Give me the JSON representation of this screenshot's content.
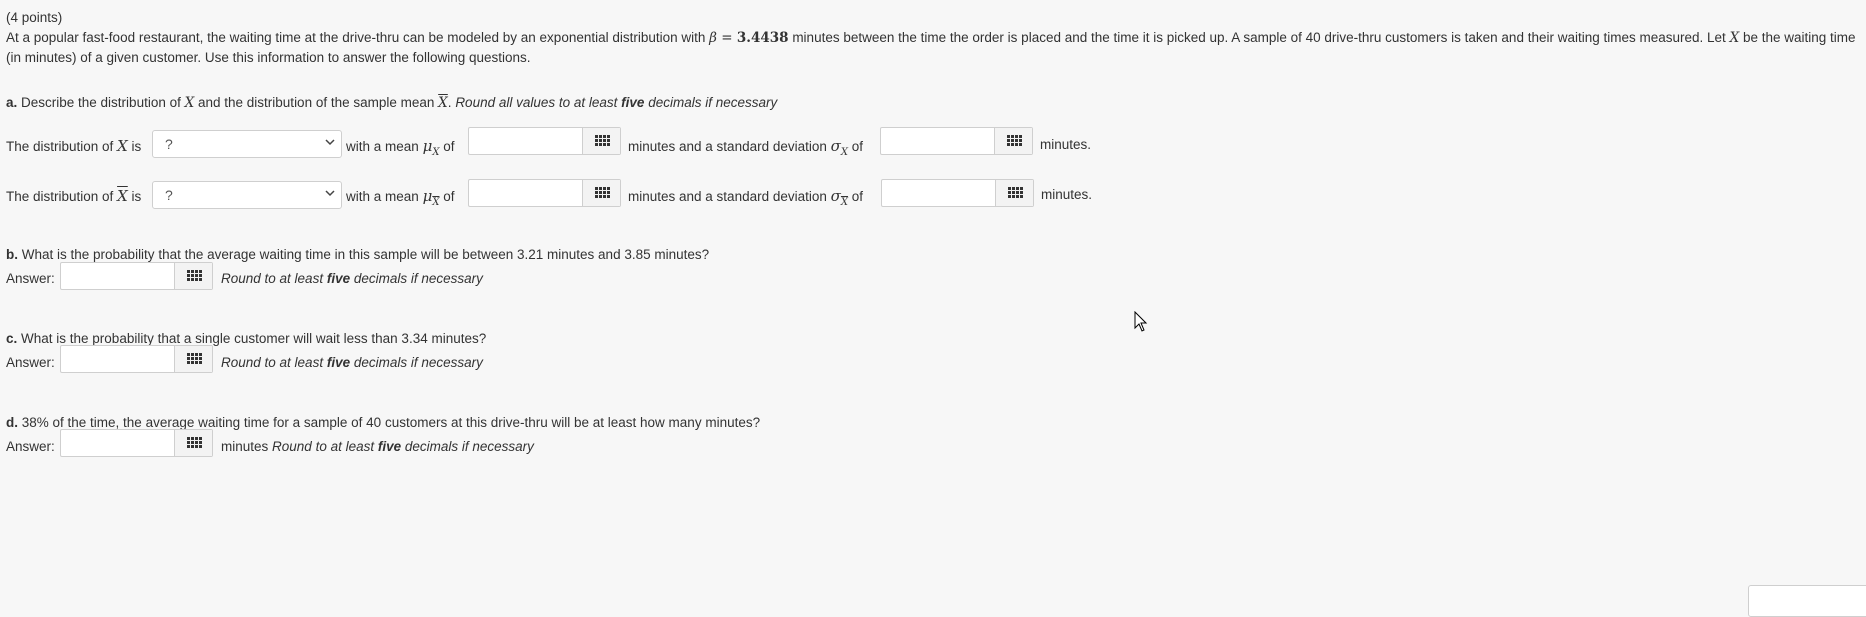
{
  "header": {
    "points": "(4 points)",
    "intro_1": "At a popular fast-food restaurant, the waiting time at the drive-thru can be modeled by an exponential distribution with",
    "beta_symbol": "β",
    "beta_eq": " = ",
    "beta_value": "3.4438",
    "intro_2": " minutes between the time the order is placed and the time it is picked up. A sample of 40 drive-thru customers is taken and their waiting times measured. Let",
    "var_x": "X",
    "intro_3": " be the waiting time (in minutes) of a given customer. Use this information to answer the following questions."
  },
  "part_a": {
    "label": "a.",
    "question_1": " Describe the distribution of",
    "var_x": "X",
    "question_2": " and the distribution of the sample mean",
    "xbar": "X",
    "question_3": ". ",
    "round_note_pre": "Round all values to at least ",
    "round_note_bold": "five",
    "round_note_post": " decimals if necessary",
    "row1": {
      "prefix": "The distribution of",
      "var": "X",
      "is": "is",
      "select_value": "?",
      "with_mean": "with a mean",
      "mu": "μ",
      "mu_sub": "X",
      "of1": "of",
      "minutes_sd": "minutes and a standard deviation",
      "sigma": "σ",
      "sigma_sub": "X",
      "of2": "of",
      "minutes_end": "minutes."
    },
    "row2": {
      "prefix": "The distribution of",
      "var": "X",
      "is": "is",
      "select_value": "?",
      "with_mean": "with a mean",
      "mu": "μ",
      "mu_sub": "X",
      "of1": "of",
      "minutes_sd": "minutes and a standard deviation",
      "sigma": "σ",
      "sigma_sub": "X",
      "of2": "of",
      "minutes_end": "minutes."
    }
  },
  "part_b": {
    "label": "b.",
    "question": " What is the probability that the average waiting time in this sample will be between 3.21 minutes and 3.85 minutes?",
    "answer_label": "Answer:",
    "note_pre": "Round to at least ",
    "note_bold": "five",
    "note_post": " decimals if necessary"
  },
  "part_c": {
    "label": "c.",
    "question": " What is the probability that a single customer will wait less than 3.34 minutes?",
    "answer_label": "Answer:",
    "note_pre": "Round to at least ",
    "note_bold": "five",
    "note_post": " decimals if necessary"
  },
  "part_d": {
    "label": "d.",
    "question": " 38% of the time, the average waiting time for a sample of 40 customers at this drive-thru will be at least how many minutes?",
    "answer_label": "Answer:",
    "unit": "minutes ",
    "note_pre": "Round to at least ",
    "note_bold": "five",
    "note_post": " decimals if necessary"
  },
  "icons": {
    "calculator": "grid-calculator-icon",
    "dropdown": "chevron-down-icon",
    "cursor": "mouse-cursor-icon"
  }
}
